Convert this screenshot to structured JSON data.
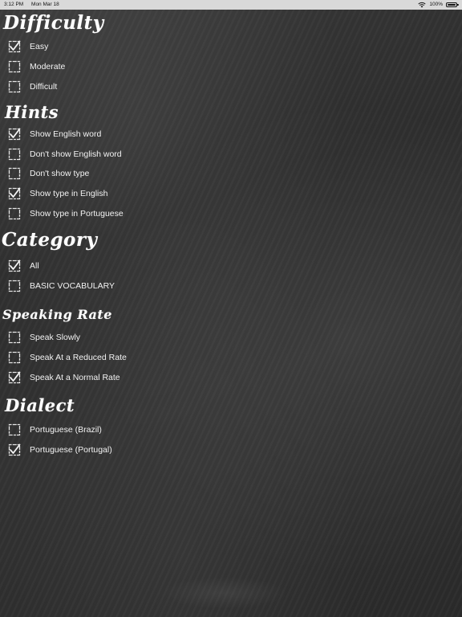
{
  "status_bar": {
    "time": "3:12 PM",
    "date": "Mon Mar 18",
    "battery": "100%"
  },
  "sections": [
    {
      "title": "Difficulty",
      "options": [
        {
          "label": "Easy",
          "checked": true
        },
        {
          "label": "Moderate",
          "checked": false
        },
        {
          "label": "Difficult",
          "checked": false
        }
      ]
    },
    {
      "title": "Hints",
      "options": [
        {
          "label": "Show English word",
          "checked": true
        },
        {
          "label": "Don't show English word",
          "checked": false
        },
        {
          "label": "Don't show type",
          "checked": false
        },
        {
          "label": "Show type in English",
          "checked": true
        },
        {
          "label": "Show type in Portuguese",
          "checked": false
        }
      ]
    },
    {
      "title": "Category",
      "options": [
        {
          "label": "All",
          "checked": true
        },
        {
          "label": "BASIC VOCABULARY",
          "checked": false
        }
      ]
    },
    {
      "title": "Speaking Rate",
      "options": [
        {
          "label": "Speak Slowly",
          "checked": false
        },
        {
          "label": "Speak At a Reduced Rate",
          "checked": false
        },
        {
          "label": "Speak At a Normal Rate",
          "checked": true
        }
      ]
    },
    {
      "title": "Dialect",
      "options": [
        {
          "label": "Portuguese (Brazil)",
          "checked": false
        },
        {
          "label": "Portuguese (Portugal)",
          "checked": true
        }
      ]
    }
  ]
}
